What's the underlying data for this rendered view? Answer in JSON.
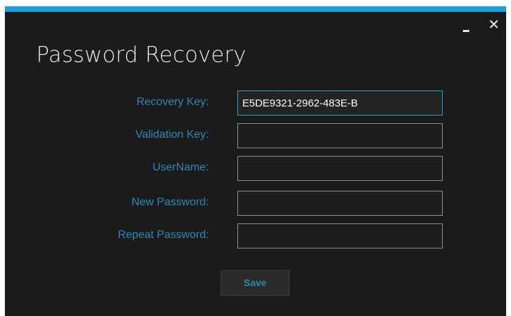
{
  "window": {
    "title": "Password Recovery",
    "minimize_icon": "minimize-icon",
    "close_icon": "close-icon",
    "close_glyph": "✕",
    "accent_color": "#1ba1e2",
    "label_color": "#2a8ab5"
  },
  "form": {
    "recovery_key": {
      "label": "Recovery Key:",
      "value": "E5DE9321-2962-483E-B"
    },
    "validation_key": {
      "label": "Validation Key:",
      "value": ""
    },
    "username": {
      "label": "UserName:",
      "value": ""
    },
    "new_password": {
      "label": "New Password:",
      "value": ""
    },
    "repeat_password": {
      "label": "Repeat Password:",
      "value": ""
    }
  },
  "actions": {
    "save_label": "Save"
  }
}
